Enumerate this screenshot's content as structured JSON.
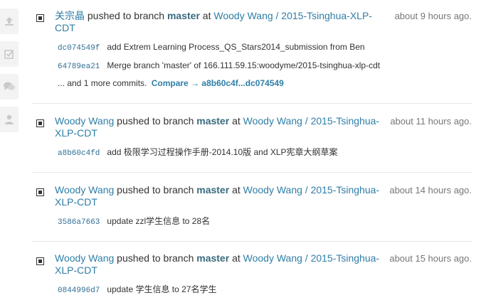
{
  "sidebar": {
    "items": [
      {
        "icon": "upload-icon"
      },
      {
        "icon": "checkbox-icon"
      },
      {
        "icon": "comments-icon"
      },
      {
        "icon": "user-icon"
      }
    ]
  },
  "events": [
    {
      "author": "关宗晶",
      "action": "pushed to branch",
      "branch": "master",
      "at": "at",
      "project_line1": "Woody Wang / 2015-Tsinghua-XLP-",
      "project_line2": "CDT",
      "time": "about 9 hours ago.",
      "commits": [
        {
          "sha": "dc074549f",
          "message": "add Extrem Learning Process_QS_Stars2014_submission from Ben"
        },
        {
          "sha": "64789ea21",
          "message": "Merge branch 'master' of 166.111.59.15:woodyme/2015-tsinghua-xlp-cdt"
        }
      ],
      "more_text": "... and 1 more commits.",
      "compare_text": "Compare → a8b60c4f...dc074549"
    },
    {
      "author": "Woody Wang",
      "action": "pushed to branch",
      "branch": "master",
      "at": "at",
      "project_line1": "Woody Wang / 2015-Tsinghua-",
      "project_line2": "XLP-CDT",
      "time": "about 11 hours ago.",
      "commits": [
        {
          "sha": "a8b60c4fd",
          "message": "add 极限学习过程操作手册-2014.10版 and XLP宪章大纲草案"
        }
      ]
    },
    {
      "author": "Woody Wang",
      "action": "pushed to branch",
      "branch": "master",
      "at": "at",
      "project_line1": "Woody Wang / 2015-Tsinghua-",
      "project_line2": "XLP-CDT",
      "time": "about 14 hours ago.",
      "commits": [
        {
          "sha": "3586a7663",
          "message": "update zzl学生信息 to 28名"
        }
      ]
    },
    {
      "author": "Woody Wang",
      "action": "pushed to branch",
      "branch": "master",
      "at": "at",
      "project_line1": "Woody Wang / 2015-Tsinghua-",
      "project_line2": "XLP-CDT",
      "time": "about 15 hours ago.",
      "commits": [
        {
          "sha": "0844996d7",
          "message": "update 学生信息 to 27名学生"
        }
      ]
    }
  ]
}
